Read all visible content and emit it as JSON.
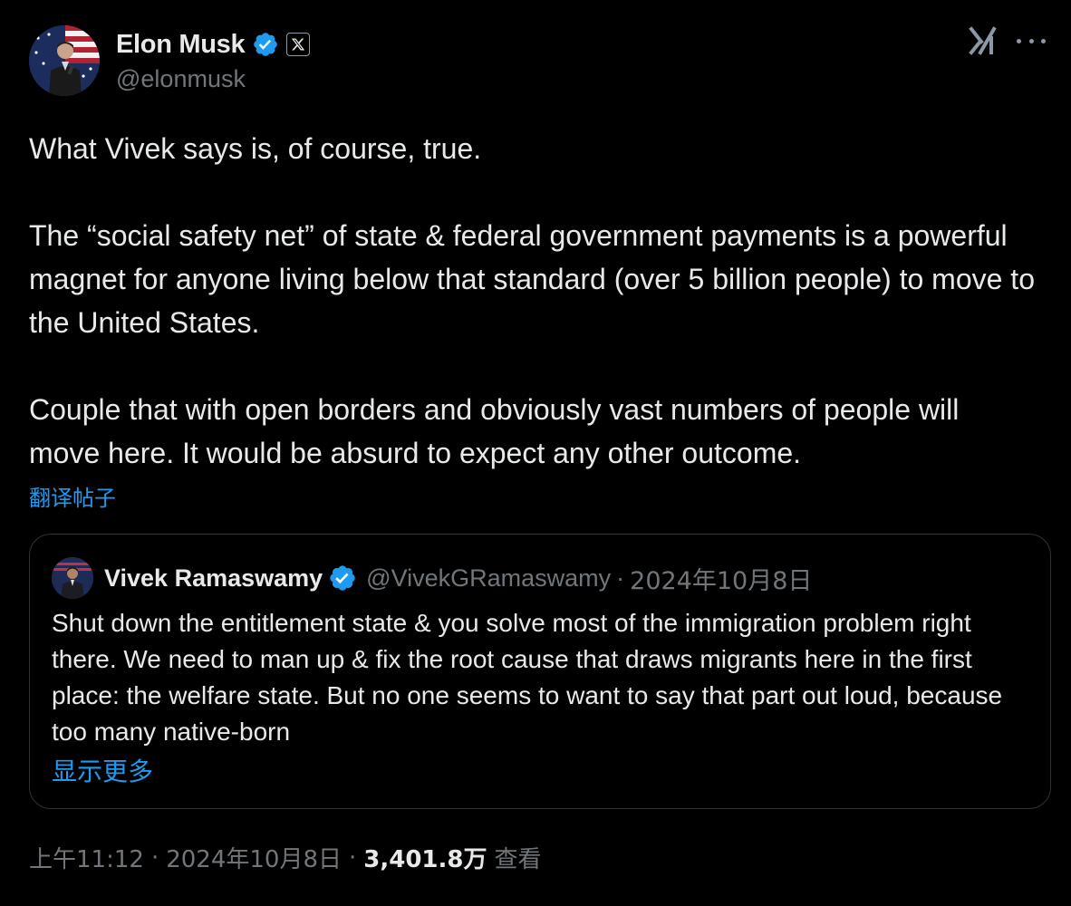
{
  "author": {
    "display_name": "Elon Musk",
    "handle": "@elonmusk",
    "avatar_icon": "avatar-elon-musk",
    "verified_color": "#1d9bf0"
  },
  "header_actions": {
    "grok_icon": "grok-icon",
    "more_icon": "more-options-icon"
  },
  "tweet": {
    "paragraphs": [
      "What Vivek says is, of course, true.",
      "The “social safety net” of state & federal government payments is a powerful magnet for anyone living below that standard (over 5 billion people) to move to the United States.",
      "Couple that with open borders and obviously vast numbers of people will move here. It would be absurd to expect any other outcome."
    ],
    "translate_label": "翻译帖子"
  },
  "quoted": {
    "display_name": "Vivek Ramaswamy",
    "handle": "@VivekGRamaswamy",
    "separator": "·",
    "date": "2024年10月8日",
    "text": "Shut down the entitlement state & you solve most of the immigration problem right there. We need to man up & fix the root cause that draws migrants here in the first place: the welfare state. But no one seems to want to say that part out loud, because too many native-born",
    "show_more_label": "显示更多"
  },
  "meta": {
    "time": "上午11:12",
    "separator": "·",
    "date": "2024年10月8日",
    "views_count": "3,401.8万",
    "views_label": "查看"
  },
  "colors": {
    "background": "#000000",
    "text_primary": "#e7e9ea",
    "text_secondary": "#71767b",
    "accent": "#1d9bf0",
    "border": "#2f3336"
  }
}
